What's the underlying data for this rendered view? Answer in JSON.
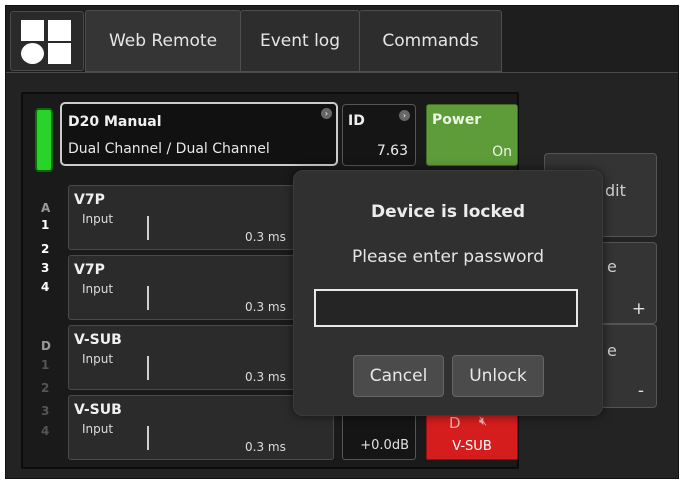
{
  "tabs": [
    {
      "label": "Web Remote",
      "active": true
    },
    {
      "label": "Event log",
      "active": false
    },
    {
      "label": "Commands",
      "active": false
    }
  ],
  "device": {
    "name": "D20 Manual",
    "mode": "Dual Channel / Dual Channel",
    "id_label": "ID",
    "id_value": "7.63",
    "power_label": "Power",
    "power_value": "On",
    "status_color": "#29d42a"
  },
  "side_labels": {
    "group_a": [
      "A",
      "1",
      "2",
      "3",
      "4"
    ],
    "group_d": [
      "D",
      "1",
      "2",
      "3",
      "4"
    ]
  },
  "channels": [
    {
      "name": "V7P",
      "input_label": "Input",
      "delay": "0.3 ms"
    },
    {
      "name": "V7P",
      "input_label": "Input",
      "delay": "0.3 ms"
    },
    {
      "name": "V-SUB",
      "input_label": "Input",
      "delay": "0.3 ms"
    },
    {
      "name": "V-SUB",
      "input_label": "Input",
      "delay": "0.3 ms"
    }
  ],
  "last_channel": {
    "gain": "+0.0dB",
    "mute_letter": "D",
    "mute_icon": "speaker-muted-icon",
    "mute_label": "V-SUB",
    "mute_color": "#d61d1d"
  },
  "right_panel": {
    "edit_fragment": "dit",
    "mid_fragment": "e",
    "plus": "+",
    "low_fragment": "e",
    "minus": "-"
  },
  "dialog": {
    "title": "Device is locked",
    "message": "Please enter password",
    "password_value": "",
    "cancel_label": "Cancel",
    "unlock_label": "Unlock"
  }
}
